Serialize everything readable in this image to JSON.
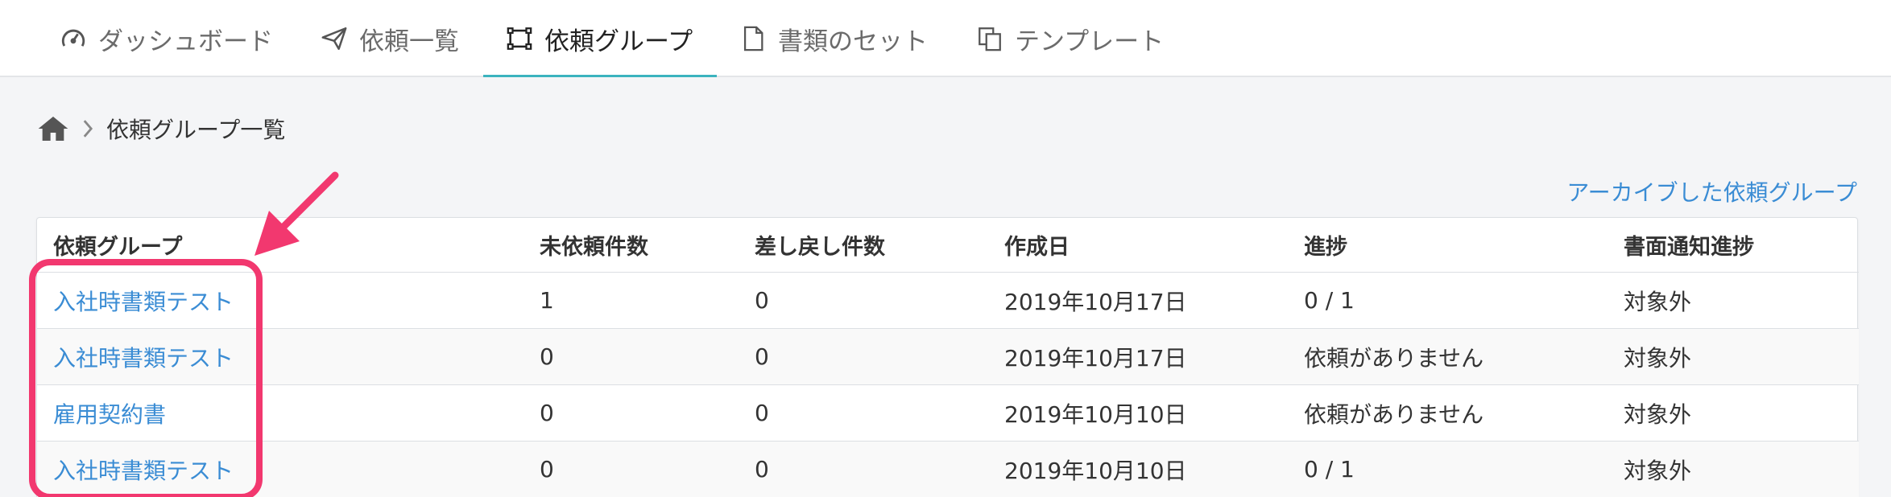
{
  "nav": {
    "tabs": [
      {
        "label": "ダッシュボード",
        "icon": "dashboard-gauge-icon"
      },
      {
        "label": "依頼一覧",
        "icon": "paper-plane-icon"
      },
      {
        "label": "依頼グループ",
        "icon": "group-frame-icon",
        "active": true
      },
      {
        "label": "書類のセット",
        "icon": "document-icon"
      },
      {
        "label": "テンプレート",
        "icon": "template-copy-icon"
      }
    ]
  },
  "breadcrumb": {
    "home_icon": "home-icon",
    "current": "依頼グループ一覧"
  },
  "archive_link": "アーカイブした依頼グループ",
  "table": {
    "headers": [
      "依頼グループ",
      "未依頼件数",
      "差し戻し件数",
      "作成日",
      "進捗",
      "書面通知進捗"
    ],
    "rows": [
      {
        "name": "入社時書類テスト",
        "pending": "1",
        "returned": "0",
        "created": "2019年10月17日",
        "progress": "0 / 1",
        "notice": "対象外"
      },
      {
        "name": "入社時書類テスト",
        "pending": "0",
        "returned": "0",
        "created": "2019年10月17日",
        "progress": "依頼がありません",
        "notice": "対象外"
      },
      {
        "name": "雇用契約書",
        "pending": "0",
        "returned": "0",
        "created": "2019年10月10日",
        "progress": "依頼がありません",
        "notice": "対象外"
      },
      {
        "name": "入社時書類テスト",
        "pending": "0",
        "returned": "0",
        "created": "2019年10月10日",
        "progress": "0 / 1",
        "notice": "対象外"
      }
    ]
  },
  "colors": {
    "accent": "#3bb3be",
    "link": "#3a8cd4",
    "highlight": "#f2386f"
  }
}
